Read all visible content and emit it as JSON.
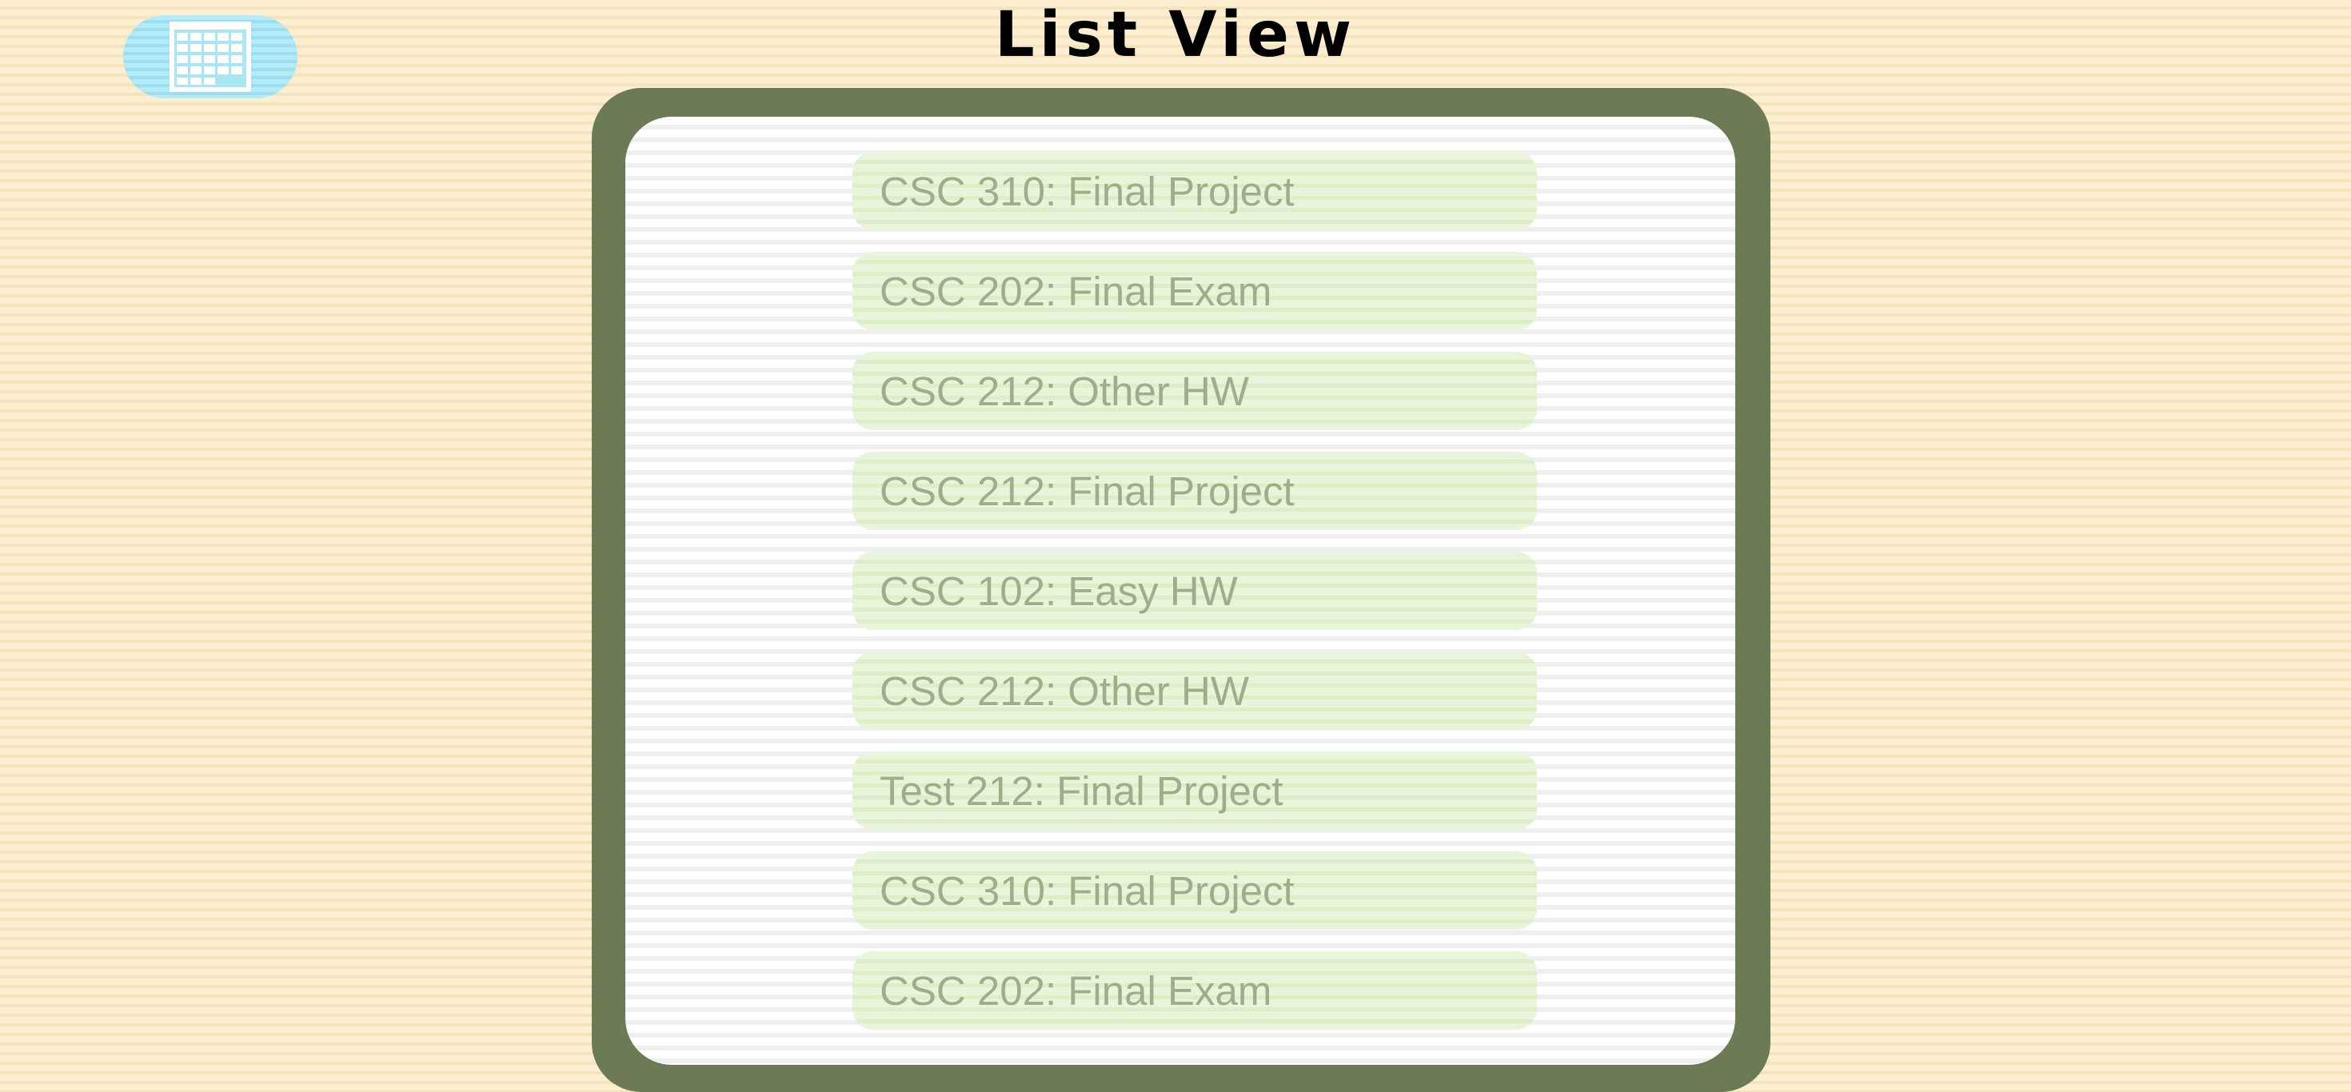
{
  "header": {
    "title": "List View",
    "calendar_button": {
      "icon": "calendar-icon",
      "color": "#a8e6f4"
    }
  },
  "list": {
    "frame_color": "#6c7a55",
    "item_color": "#e6f3d5",
    "text_color": "#9daf88",
    "items": [
      {
        "label": "CSC 310: Final Project"
      },
      {
        "label": "CSC 202: Final Exam"
      },
      {
        "label": "CSC 212: Other HW"
      },
      {
        "label": "CSC 212: Final Project"
      },
      {
        "label": "CSC 102: Easy HW"
      },
      {
        "label": "CSC 212: Other HW"
      },
      {
        "label": "Test 212: Final Project"
      },
      {
        "label": "CSC 310: Final Project"
      },
      {
        "label": "CSC 202: Final Exam"
      }
    ]
  }
}
